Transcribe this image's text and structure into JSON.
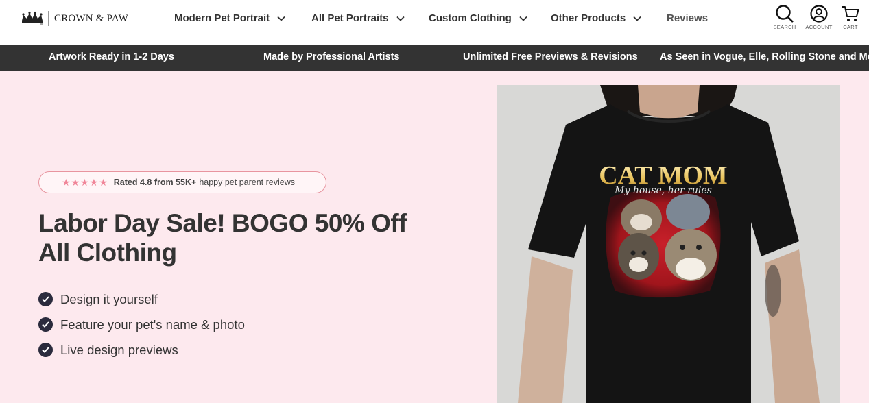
{
  "brand": {
    "name": "CROWN & PAW"
  },
  "nav": [
    {
      "label": "Modern Pet Portrait",
      "has_dropdown": true
    },
    {
      "label": "All Pet Portraits",
      "has_dropdown": true
    },
    {
      "label": "Custom Clothing",
      "has_dropdown": true
    },
    {
      "label": "Other Products",
      "has_dropdown": true
    },
    {
      "label": "Reviews",
      "has_dropdown": false
    }
  ],
  "header_icons": {
    "search": "SEARCH",
    "account": "ACCOUNT",
    "cart": "CART"
  },
  "announcement_bar": [
    "Artwork Ready in 1-2 Days",
    "Made by Professional Artists",
    "Unlimited Free Previews & Revisions",
    "As Seen in Vogue, Elle, Rolling Stone and Mo"
  ],
  "hero": {
    "rating": {
      "stars": "★★★★★",
      "bold": "Rated 4.8 from 55K+",
      "rest": "happy pet parent reviews"
    },
    "headline_line1": "Labor Day Sale! BOGO 50% Off",
    "headline_line2": "All Clothing",
    "features": [
      "Design it yourself",
      "Feature your pet's name & photo",
      "Live design previews"
    ],
    "product_image": {
      "shirt_title": "CAT MOM",
      "shirt_subtitle": "My house, her rules"
    }
  },
  "colors": {
    "hero_bg": "#fde9ee",
    "bar_bg": "#333333",
    "accent_pink": "#f08598",
    "check_bg": "#2b2b3d"
  }
}
